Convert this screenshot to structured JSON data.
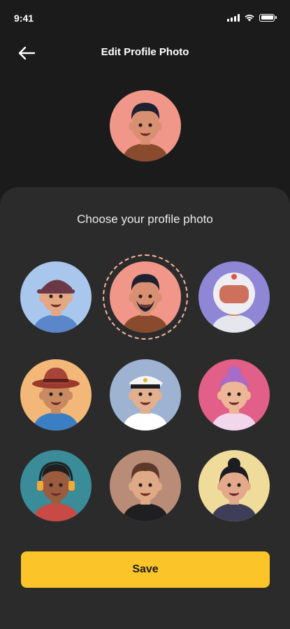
{
  "status_bar": {
    "time": "9:41"
  },
  "header": {
    "title": "Edit Profile Photo"
  },
  "sheet": {
    "title": "Choose your profile photo",
    "selected_index": 1,
    "avatars": [
      {
        "bg": "#a9c7ec",
        "skin": "#e3a882",
        "hair": "#6b3848",
        "hat": "cap",
        "outfit": "#5b86c9"
      },
      {
        "bg": "#f1978a",
        "skin": "#d99072",
        "hair": "#1e2230",
        "hat": "none",
        "outfit": "#8a4a2e",
        "beard": true
      },
      {
        "bg": "#8f86d6",
        "skin": "#d9906f",
        "hair": "#e9e9ee",
        "hat": "helmet",
        "outfit": "#e6e6ee"
      },
      {
        "bg": "#f3b778",
        "skin": "#c98a62",
        "hair": "#8e3a2e",
        "hat": "fedora",
        "outfit": "#3a7fc4"
      },
      {
        "bg": "#9eb2d2",
        "skin": "#e3b08d",
        "hair": "#f2f2f2",
        "hat": "captain",
        "outfit": "#ffffff"
      },
      {
        "bg": "#e15f88",
        "skin": "#edb696",
        "hair": "#a86bc7",
        "hat": "bun",
        "outfit": "#f2d6ec"
      },
      {
        "bg": "#3a8c99",
        "skin": "#9b5b3e",
        "hair": "#1f1f1f",
        "hat": "headset",
        "outfit": "#c94a44"
      },
      {
        "bg": "#b98c77",
        "skin": "#e0a986",
        "hair": "#5a3a2a",
        "hat": "none",
        "outfit": "#1f1f22"
      },
      {
        "bg": "#f0dc9a",
        "skin": "#e3a98a",
        "hair": "#1c1c22",
        "hat": "bun-dark",
        "outfit": "#3e3e58"
      }
    ]
  },
  "current_avatar": {
    "bg": "#f1978a",
    "skin": "#d99072",
    "hair": "#1e2230",
    "outfit": "#8a4a2e"
  },
  "save_label": "Save",
  "colors": {
    "accent": "#fbc52a",
    "sheet": "#2b2b2b",
    "background": "#1b1b1b"
  }
}
